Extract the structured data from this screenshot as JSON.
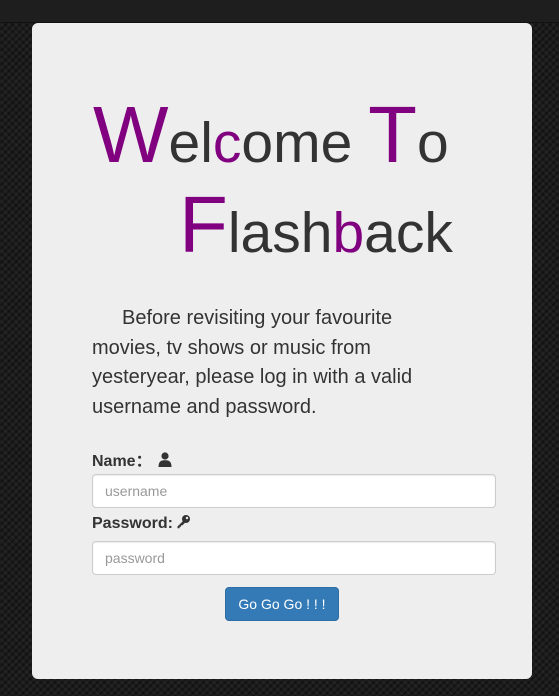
{
  "welcome": {
    "line1": {
      "cap_w": "W",
      "el": "el",
      "c": "c",
      "ome": "ome ",
      "cap_t": "T",
      "o": "o"
    },
    "line2": {
      "cap_f": "F",
      "lash": "lash",
      "b": "b",
      "ack": "ack"
    }
  },
  "intro_text": "Before revisiting your favourite movies, tv shows or music from yesteryear, please log in with a valid username and password.",
  "form": {
    "name_label": "Name：",
    "username_placeholder": "username",
    "password_label": "Password:",
    "password_placeholder": "password",
    "submit_label": "Go Go Go ! ! !"
  },
  "colors": {
    "accent": "#800080",
    "button": "#337ab7",
    "card": "#eeeeee",
    "text": "#333333"
  },
  "icons": {
    "name": "user-icon",
    "password": "key-icon"
  }
}
